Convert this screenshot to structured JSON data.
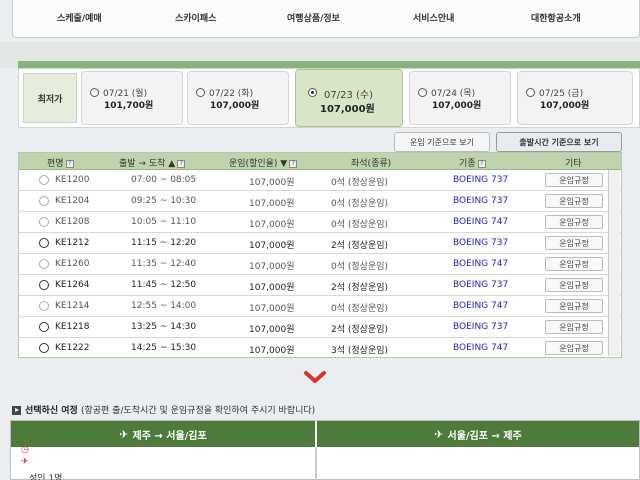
{
  "nav": {
    "items": [
      "스케줄/예매",
      "스카이패스",
      "여행상품/정보",
      "서비스안내",
      "대한항공소개"
    ]
  },
  "dates": {
    "lowest_label": "최저가",
    "items": [
      {
        "date": "07/21 (월)",
        "price": "101,700원",
        "selected": false
      },
      {
        "date": "07/22 (화)",
        "price": "107,000원",
        "selected": false
      },
      {
        "date": "07/23 (수)",
        "price": "107,000원",
        "selected": true
      },
      {
        "date": "07/24 (목)",
        "price": "107,000원",
        "selected": false
      },
      {
        "date": "07/25 (금)",
        "price": "107,000원",
        "selected": false
      }
    ]
  },
  "sort": {
    "by_fare": "운임 기준으로 보기",
    "by_departure": "출발시간 기준으로 보기"
  },
  "table": {
    "headers": {
      "flight": "편명",
      "time": "출발 → 도착 ▲",
      "fare": "운임(할인율) ▼",
      "seats": "좌석(종류)",
      "aircraft": "기종",
      "etc": "기타"
    },
    "rows": [
      {
        "flight": "KE1200",
        "time": "07:00 ~ 08:05",
        "fare": "107,000원",
        "seats": "0석 (정상운임)",
        "aircraft": "BOEING 737",
        "button": "운임규정",
        "disabled": true
      },
      {
        "flight": "KE1204",
        "time": "09:25 ~ 10:30",
        "fare": "107,000원",
        "seats": "0석 (정상운임)",
        "aircraft": "BOEING 737",
        "button": "운임규정",
        "disabled": true
      },
      {
        "flight": "KE1208",
        "time": "10:05 ~ 11:10",
        "fare": "107,000원",
        "seats": "0석 (정상운임)",
        "aircraft": "BOEING 747",
        "button": "운임규정",
        "disabled": true
      },
      {
        "flight": "KE1212",
        "time": "11:15 ~ 12:20",
        "fare": "107,000원",
        "seats": "2석 (정상운임)",
        "aircraft": "BOEING 737",
        "button": "운임규정",
        "disabled": false
      },
      {
        "flight": "KE1260",
        "time": "11:35 ~ 12:40",
        "fare": "107,000원",
        "seats": "0석 (정상운임)",
        "aircraft": "BOEING 747",
        "button": "운임규정",
        "disabled": true
      },
      {
        "flight": "KE1264",
        "time": "11:45 ~ 12:50",
        "fare": "107,000원",
        "seats": "2석 (정상운임)",
        "aircraft": "BOEING 737",
        "button": "운임규정",
        "disabled": false
      },
      {
        "flight": "KE1214",
        "time": "12:55 ~ 14:00",
        "fare": "107,000원",
        "seats": "0석 (정상운임)",
        "aircraft": "BOEING 747",
        "button": "운임규정",
        "disabled": true
      },
      {
        "flight": "KE1218",
        "time": "13:25 ~ 14:30",
        "fare": "107,000원",
        "seats": "2석 (정상운임)",
        "aircraft": "BOEING 737",
        "button": "운임규정",
        "disabled": false
      },
      {
        "flight": "KE1222",
        "time": "14:25 ~ 15:30",
        "fare": "107,000원",
        "seats": "3석 (정상운임)",
        "aircraft": "BOEING 747",
        "button": "운임규정",
        "disabled": false
      }
    ]
  },
  "selection": {
    "title": "선택하신 여정",
    "note": "(항공편 출/도착시간 및 운임규정을 확인하여 주시기 바랍니다)",
    "outbound": "제주 → 서울/김포",
    "inbound": "서울/김포 → 제주",
    "passenger": "성인 1명"
  },
  "colors": {
    "header_green": "#bfd3ad",
    "aircraft_blue": "#2222bb",
    "selected_date": "#d7e6c6",
    "section_green": "#4e7a3b",
    "chevron_red": "#d9352b"
  },
  "icons": {
    "section": "triangle-bullet-icon",
    "plane": "plane-icon",
    "clock": "clock-icon",
    "chevron": "chevron-down-icon"
  }
}
